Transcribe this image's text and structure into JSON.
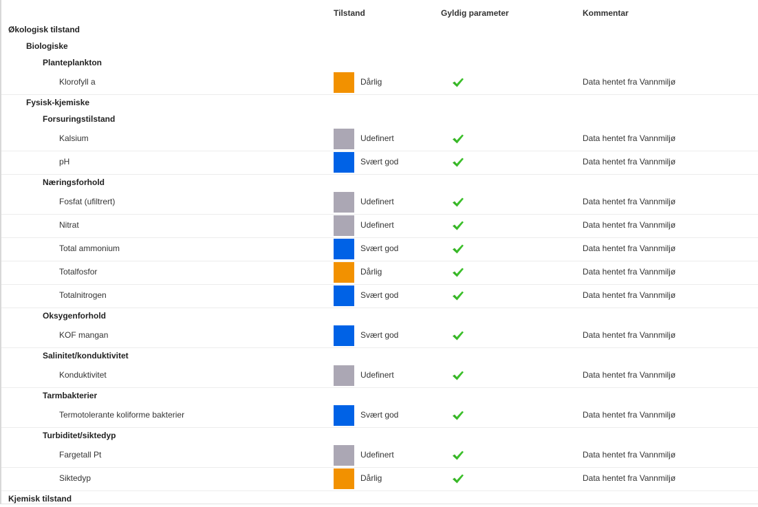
{
  "columns": {
    "tilstand": "Tilstand",
    "gyldig": "Gyldig parameter",
    "kommentar": "Kommentar"
  },
  "status_colors": {
    "Dårlig": "#f29100",
    "Udefinert": "#aba7b4",
    "Svært god": "#0062e6"
  },
  "check_icon": "check-icon",
  "check_color": "#3bbf2a",
  "rows": [
    {
      "type": "group",
      "level": 0,
      "label": "Økologisk tilstand"
    },
    {
      "type": "group",
      "level": 1,
      "label": "Biologiske"
    },
    {
      "type": "group",
      "level": 2,
      "label": "Planteplankton"
    },
    {
      "type": "param",
      "name": "Klorofyll a",
      "status": "Dårlig",
      "valid": true,
      "comment": "Data hentet fra Vannmiljø"
    },
    {
      "type": "group",
      "level": 1,
      "label": "Fysisk-kjemiske"
    },
    {
      "type": "group",
      "level": 2,
      "label": "Forsuringstilstand"
    },
    {
      "type": "param",
      "name": "Kalsium",
      "status": "Udefinert",
      "valid": true,
      "comment": "Data hentet fra Vannmiljø"
    },
    {
      "type": "param",
      "name": "pH",
      "status": "Svært god",
      "valid": true,
      "comment": "Data hentet fra Vannmiljø"
    },
    {
      "type": "group",
      "level": 2,
      "label": "Næringsforhold"
    },
    {
      "type": "param",
      "name": "Fosfat (ufiltrert)",
      "status": "Udefinert",
      "valid": true,
      "comment": "Data hentet fra Vannmiljø"
    },
    {
      "type": "param",
      "name": "Nitrat",
      "status": "Udefinert",
      "valid": true,
      "comment": "Data hentet fra Vannmiljø"
    },
    {
      "type": "param",
      "name": "Total ammonium",
      "status": "Svært god",
      "valid": true,
      "comment": "Data hentet fra Vannmiljø"
    },
    {
      "type": "param",
      "name": "Totalfosfor",
      "status": "Dårlig",
      "valid": true,
      "comment": "Data hentet fra Vannmiljø"
    },
    {
      "type": "param",
      "name": "Totalnitrogen",
      "status": "Svært god",
      "valid": true,
      "comment": "Data hentet fra Vannmiljø"
    },
    {
      "type": "group",
      "level": 2,
      "label": "Oksygenforhold"
    },
    {
      "type": "param",
      "name": "KOF mangan",
      "status": "Svært god",
      "valid": true,
      "comment": "Data hentet fra Vannmiljø"
    },
    {
      "type": "group",
      "level": 2,
      "label": "Salinitet/konduktivitet"
    },
    {
      "type": "param",
      "name": "Konduktivitet",
      "status": "Udefinert",
      "valid": true,
      "comment": "Data hentet fra Vannmiljø"
    },
    {
      "type": "group",
      "level": 2,
      "label": "Tarmbakterier"
    },
    {
      "type": "param",
      "name": "Termotolerante koliforme bakterier",
      "status": "Svært god",
      "valid": true,
      "comment": "Data hentet fra Vannmiljø"
    },
    {
      "type": "group",
      "level": 2,
      "label": "Turbiditet/siktedyp"
    },
    {
      "type": "param",
      "name": "Fargetall Pt",
      "status": "Udefinert",
      "valid": true,
      "comment": "Data hentet fra Vannmiljø"
    },
    {
      "type": "param",
      "name": "Siktedyp",
      "status": "Dårlig",
      "valid": true,
      "comment": "Data hentet fra Vannmiljø"
    },
    {
      "type": "group",
      "level": 0,
      "label": "Kjemisk tilstand"
    }
  ]
}
